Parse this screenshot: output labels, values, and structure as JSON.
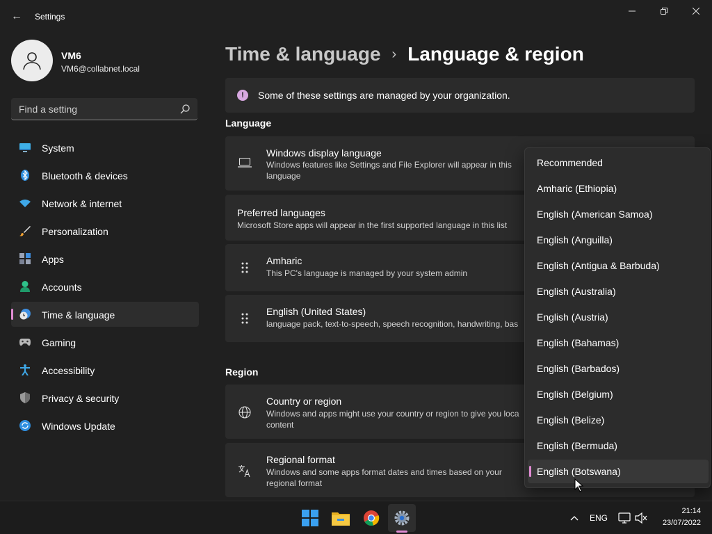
{
  "window": {
    "title": "Settings",
    "back_glyph": "←",
    "minimize_glyph": "—",
    "maximize_glyph": "❐",
    "close_glyph": "✕"
  },
  "profile": {
    "name": "VM6",
    "email": "VM6@collabnet.local"
  },
  "search": {
    "placeholder": "Find a setting"
  },
  "sidebar": {
    "items": [
      {
        "label": "System",
        "icon": "system-icon"
      },
      {
        "label": "Bluetooth & devices",
        "icon": "bluetooth-icon"
      },
      {
        "label": "Network & internet",
        "icon": "wifi-icon"
      },
      {
        "label": "Personalization",
        "icon": "brush-icon"
      },
      {
        "label": "Apps",
        "icon": "apps-icon"
      },
      {
        "label": "Accounts",
        "icon": "person-icon"
      },
      {
        "label": "Time & language",
        "icon": "clock-globe-icon",
        "active": true
      },
      {
        "label": "Gaming",
        "icon": "gamepad-icon"
      },
      {
        "label": "Accessibility",
        "icon": "accessibility-icon"
      },
      {
        "label": "Privacy & security",
        "icon": "shield-icon"
      },
      {
        "label": "Windows Update",
        "icon": "update-icon"
      }
    ]
  },
  "breadcrumb": {
    "parent": "Time & language",
    "separator": "›",
    "current": "Language & region"
  },
  "notice": {
    "icon_glyph": "!",
    "text": "Some of these settings are managed by your organization."
  },
  "language_section": {
    "title": "Language",
    "display_language": {
      "title": "Windows display language",
      "desc": "Windows features like Settings and File Explorer will appear in this language"
    },
    "preferred": {
      "title": "Preferred languages",
      "desc": "Microsoft Store apps will appear in the first supported language in this list"
    },
    "languages": [
      {
        "title": "Amharic",
        "desc": "This PC's language is managed by your system admin"
      },
      {
        "title": "English (United States)",
        "desc": "language pack, text-to-speech, speech recognition, handwriting, bas"
      }
    ]
  },
  "region_section": {
    "title": "Region",
    "country": {
      "title": "Country or region",
      "desc": "Windows and apps might use your country or region to give you loca content"
    },
    "format": {
      "title": "Regional format",
      "desc": "Windows and some apps format dates and times based on your regional format"
    }
  },
  "dropdown": {
    "items": [
      "Recommended",
      "Amharic (Ethiopia)",
      "English (American Samoa)",
      "English (Anguilla)",
      "English (Antigua & Barbuda)",
      "English (Australia)",
      "English (Austria)",
      "English (Bahamas)",
      "English (Barbados)",
      "English (Belgium)",
      "English (Belize)",
      "English (Bermuda)",
      "English (Botswana)"
    ],
    "selected": "English (Botswana)"
  },
  "taskbar": {
    "apps": [
      "start-icon",
      "file-explorer-icon",
      "chrome-icon",
      "settings-icon"
    ],
    "lang": "ENG",
    "time": "21:14",
    "date": "23/07/2022"
  },
  "colors": {
    "background": "#202020",
    "card": "#2b2b2b",
    "accent": "#e08bd3"
  }
}
